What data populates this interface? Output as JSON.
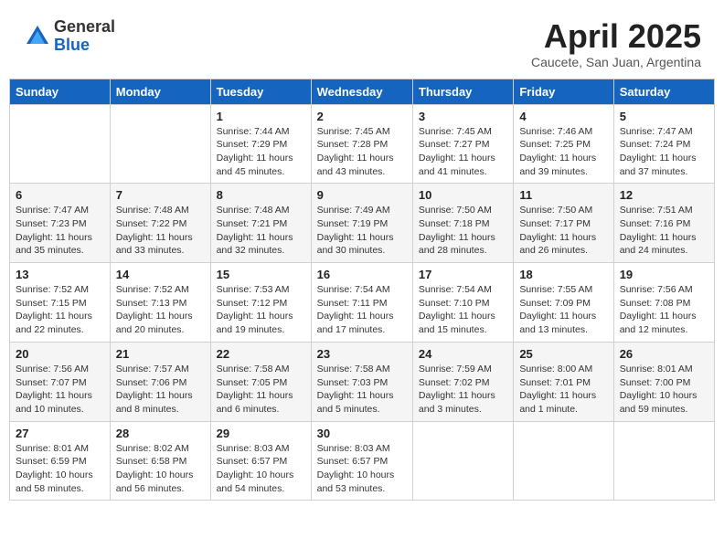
{
  "header": {
    "logo_general": "General",
    "logo_blue": "Blue",
    "month_title": "April 2025",
    "subtitle": "Caucete, San Juan, Argentina"
  },
  "days_of_week": [
    "Sunday",
    "Monday",
    "Tuesday",
    "Wednesday",
    "Thursday",
    "Friday",
    "Saturday"
  ],
  "weeks": [
    [
      {
        "day": "",
        "sunrise": "",
        "sunset": "",
        "daylight": ""
      },
      {
        "day": "",
        "sunrise": "",
        "sunset": "",
        "daylight": ""
      },
      {
        "day": "1",
        "sunrise": "Sunrise: 7:44 AM",
        "sunset": "Sunset: 7:29 PM",
        "daylight": "Daylight: 11 hours and 45 minutes."
      },
      {
        "day": "2",
        "sunrise": "Sunrise: 7:45 AM",
        "sunset": "Sunset: 7:28 PM",
        "daylight": "Daylight: 11 hours and 43 minutes."
      },
      {
        "day": "3",
        "sunrise": "Sunrise: 7:45 AM",
        "sunset": "Sunset: 7:27 PM",
        "daylight": "Daylight: 11 hours and 41 minutes."
      },
      {
        "day": "4",
        "sunrise": "Sunrise: 7:46 AM",
        "sunset": "Sunset: 7:25 PM",
        "daylight": "Daylight: 11 hours and 39 minutes."
      },
      {
        "day": "5",
        "sunrise": "Sunrise: 7:47 AM",
        "sunset": "Sunset: 7:24 PM",
        "daylight": "Daylight: 11 hours and 37 minutes."
      }
    ],
    [
      {
        "day": "6",
        "sunrise": "Sunrise: 7:47 AM",
        "sunset": "Sunset: 7:23 PM",
        "daylight": "Daylight: 11 hours and 35 minutes."
      },
      {
        "day": "7",
        "sunrise": "Sunrise: 7:48 AM",
        "sunset": "Sunset: 7:22 PM",
        "daylight": "Daylight: 11 hours and 33 minutes."
      },
      {
        "day": "8",
        "sunrise": "Sunrise: 7:48 AM",
        "sunset": "Sunset: 7:21 PM",
        "daylight": "Daylight: 11 hours and 32 minutes."
      },
      {
        "day": "9",
        "sunrise": "Sunrise: 7:49 AM",
        "sunset": "Sunset: 7:19 PM",
        "daylight": "Daylight: 11 hours and 30 minutes."
      },
      {
        "day": "10",
        "sunrise": "Sunrise: 7:50 AM",
        "sunset": "Sunset: 7:18 PM",
        "daylight": "Daylight: 11 hours and 28 minutes."
      },
      {
        "day": "11",
        "sunrise": "Sunrise: 7:50 AM",
        "sunset": "Sunset: 7:17 PM",
        "daylight": "Daylight: 11 hours and 26 minutes."
      },
      {
        "day": "12",
        "sunrise": "Sunrise: 7:51 AM",
        "sunset": "Sunset: 7:16 PM",
        "daylight": "Daylight: 11 hours and 24 minutes."
      }
    ],
    [
      {
        "day": "13",
        "sunrise": "Sunrise: 7:52 AM",
        "sunset": "Sunset: 7:15 PM",
        "daylight": "Daylight: 11 hours and 22 minutes."
      },
      {
        "day": "14",
        "sunrise": "Sunrise: 7:52 AM",
        "sunset": "Sunset: 7:13 PM",
        "daylight": "Daylight: 11 hours and 20 minutes."
      },
      {
        "day": "15",
        "sunrise": "Sunrise: 7:53 AM",
        "sunset": "Sunset: 7:12 PM",
        "daylight": "Daylight: 11 hours and 19 minutes."
      },
      {
        "day": "16",
        "sunrise": "Sunrise: 7:54 AM",
        "sunset": "Sunset: 7:11 PM",
        "daylight": "Daylight: 11 hours and 17 minutes."
      },
      {
        "day": "17",
        "sunrise": "Sunrise: 7:54 AM",
        "sunset": "Sunset: 7:10 PM",
        "daylight": "Daylight: 11 hours and 15 minutes."
      },
      {
        "day": "18",
        "sunrise": "Sunrise: 7:55 AM",
        "sunset": "Sunset: 7:09 PM",
        "daylight": "Daylight: 11 hours and 13 minutes."
      },
      {
        "day": "19",
        "sunrise": "Sunrise: 7:56 AM",
        "sunset": "Sunset: 7:08 PM",
        "daylight": "Daylight: 11 hours and 12 minutes."
      }
    ],
    [
      {
        "day": "20",
        "sunrise": "Sunrise: 7:56 AM",
        "sunset": "Sunset: 7:07 PM",
        "daylight": "Daylight: 11 hours and 10 minutes."
      },
      {
        "day": "21",
        "sunrise": "Sunrise: 7:57 AM",
        "sunset": "Sunset: 7:06 PM",
        "daylight": "Daylight: 11 hours and 8 minutes."
      },
      {
        "day": "22",
        "sunrise": "Sunrise: 7:58 AM",
        "sunset": "Sunset: 7:05 PM",
        "daylight": "Daylight: 11 hours and 6 minutes."
      },
      {
        "day": "23",
        "sunrise": "Sunrise: 7:58 AM",
        "sunset": "Sunset: 7:03 PM",
        "daylight": "Daylight: 11 hours and 5 minutes."
      },
      {
        "day": "24",
        "sunrise": "Sunrise: 7:59 AM",
        "sunset": "Sunset: 7:02 PM",
        "daylight": "Daylight: 11 hours and 3 minutes."
      },
      {
        "day": "25",
        "sunrise": "Sunrise: 8:00 AM",
        "sunset": "Sunset: 7:01 PM",
        "daylight": "Daylight: 11 hours and 1 minute."
      },
      {
        "day": "26",
        "sunrise": "Sunrise: 8:01 AM",
        "sunset": "Sunset: 7:00 PM",
        "daylight": "Daylight: 10 hours and 59 minutes."
      }
    ],
    [
      {
        "day": "27",
        "sunrise": "Sunrise: 8:01 AM",
        "sunset": "Sunset: 6:59 PM",
        "daylight": "Daylight: 10 hours and 58 minutes."
      },
      {
        "day": "28",
        "sunrise": "Sunrise: 8:02 AM",
        "sunset": "Sunset: 6:58 PM",
        "daylight": "Daylight: 10 hours and 56 minutes."
      },
      {
        "day": "29",
        "sunrise": "Sunrise: 8:03 AM",
        "sunset": "Sunset: 6:57 PM",
        "daylight": "Daylight: 10 hours and 54 minutes."
      },
      {
        "day": "30",
        "sunrise": "Sunrise: 8:03 AM",
        "sunset": "Sunset: 6:57 PM",
        "daylight": "Daylight: 10 hours and 53 minutes."
      },
      {
        "day": "",
        "sunrise": "",
        "sunset": "",
        "daylight": ""
      },
      {
        "day": "",
        "sunrise": "",
        "sunset": "",
        "daylight": ""
      },
      {
        "day": "",
        "sunrise": "",
        "sunset": "",
        "daylight": ""
      }
    ]
  ]
}
